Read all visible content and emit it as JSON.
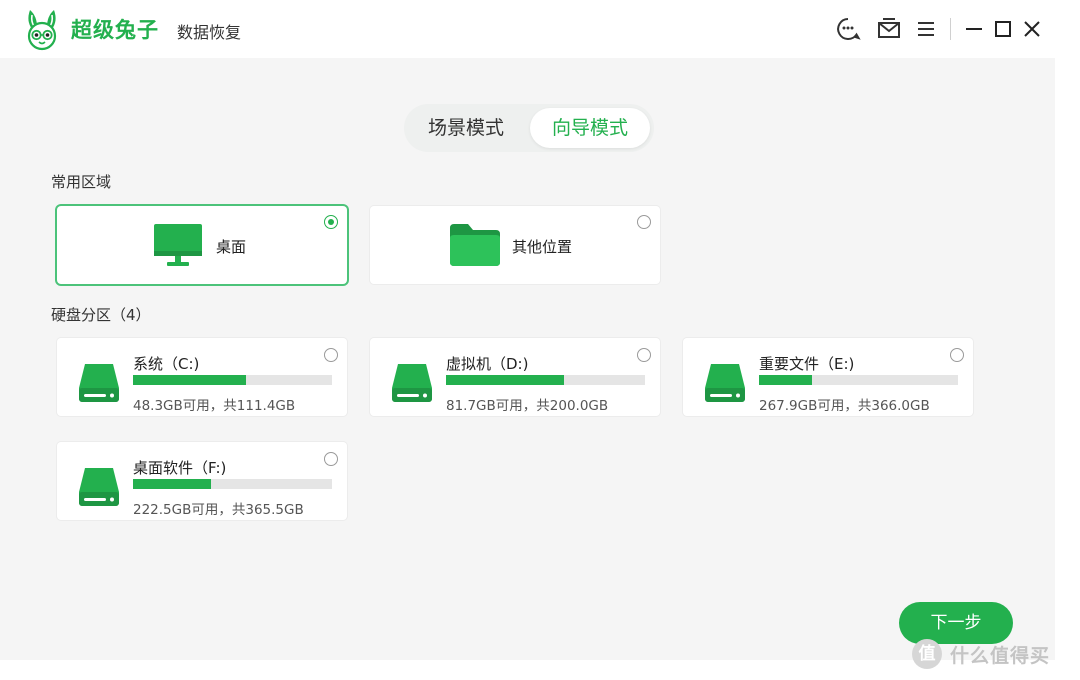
{
  "app": {
    "brand_name": "超级兔子",
    "brand_sub": "数据恢复"
  },
  "titlebar_icons": [
    "support-chat-icon",
    "mail-icon",
    "menu-icon",
    "minimize-icon",
    "maximize-icon",
    "close-icon"
  ],
  "mode_tabs": [
    {
      "label": "场景模式",
      "active": false
    },
    {
      "label": "向导模式",
      "active": true
    }
  ],
  "common_areas": {
    "label": "常用区域",
    "items": [
      {
        "label": "桌面",
        "selected": true,
        "icon": "monitor-icon"
      },
      {
        "label": "其他位置",
        "selected": false,
        "icon": "folder-icon"
      }
    ]
  },
  "partitions": {
    "label": "硬盘分区（4）",
    "items": [
      {
        "name": "系统（C:)",
        "size": "48.3GB可用，共111.4GB",
        "used_fraction": 0.566,
        "selected": false
      },
      {
        "name": "虚拟机（D:)",
        "size": "81.7GB可用，共200.0GB",
        "used_fraction": 0.5915,
        "selected": false
      },
      {
        "name": "重要文件（E:)",
        "size": "267.9GB可用，共366.0GB",
        "used_fraction": 0.268,
        "selected": false
      },
      {
        "name": "桌面软件（F:)",
        "size": "222.5GB可用，共365.5GB",
        "used_fraction": 0.391,
        "selected": false
      }
    ]
  },
  "next_button": "下一步",
  "watermark": {
    "badge": "值",
    "text": "什么值得买"
  },
  "colors": {
    "accent": "#23b04e",
    "background": "#f5f5f5",
    "card": "#ffffff"
  }
}
